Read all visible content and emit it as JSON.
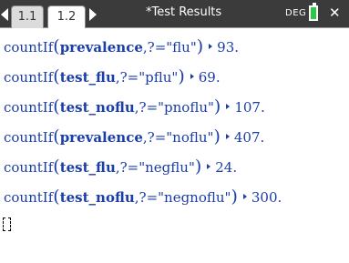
{
  "header": {
    "tab_inactive": "1.1",
    "tab_active": "1.2",
    "title": "*Test Results",
    "mode": "DEG",
    "icons": {
      "prev": "triangle-left",
      "next": "triangle-right",
      "battery": "battery",
      "close": "close-x"
    },
    "colors": {
      "bar": "#3b3b3b",
      "battery": "#2cc84a",
      "text": "#1a3da8"
    }
  },
  "entries": [
    {
      "fn": "countIf",
      "arg": "prevalence",
      "cond": ",?=\"flu\"",
      "result": "93."
    },
    {
      "fn": "countIf",
      "arg": "test_flu",
      "cond": ",?=\"pflu\"",
      "result": "69."
    },
    {
      "fn": "countIf",
      "arg": "test_noflu",
      "cond": ",?=\"pnoflu\"",
      "result": "107."
    },
    {
      "fn": "countIf",
      "arg": "prevalence",
      "cond": ",?=\"noflu\"",
      "result": "407."
    },
    {
      "fn": "countIf",
      "arg": "test_flu",
      "cond": ",?=\"negflu\"",
      "result": "24."
    },
    {
      "fn": "countIf",
      "arg": "test_noflu",
      "cond": ",?=\"negnoflu\"",
      "result": "300."
    }
  ],
  "paren": {
    "open": "(",
    "close": ")"
  }
}
